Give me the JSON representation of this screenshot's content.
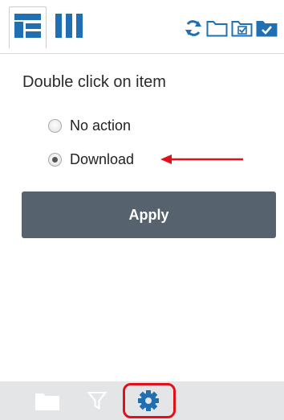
{
  "toolbar": {
    "view_buttons": [
      {
        "icon": "detail-view-icon",
        "active": true
      },
      {
        "icon": "column-view-icon",
        "active": false
      }
    ],
    "actions": [
      {
        "icon": "refresh-icon"
      },
      {
        "icon": "new-folder-icon"
      },
      {
        "icon": "select-folder-icon"
      },
      {
        "icon": "folder-checked-icon"
      }
    ],
    "icon_color": "#1f6fb2"
  },
  "settings": {
    "heading": "Double click on item",
    "options": [
      {
        "label": "No action",
        "selected": false
      },
      {
        "label": "Download",
        "selected": true
      }
    ],
    "apply_label": "Apply"
  },
  "annotation": {
    "arrow_color": "#e0111b",
    "highlight_color": "#e0111b"
  },
  "bottom_bar": {
    "tabs": [
      {
        "icon": "folder-icon",
        "active": false
      },
      {
        "icon": "filter-icon",
        "active": false
      },
      {
        "icon": "gear-icon",
        "active": true
      }
    ],
    "active_color": "#1f6fb2",
    "inactive_color": "#ffffff"
  }
}
